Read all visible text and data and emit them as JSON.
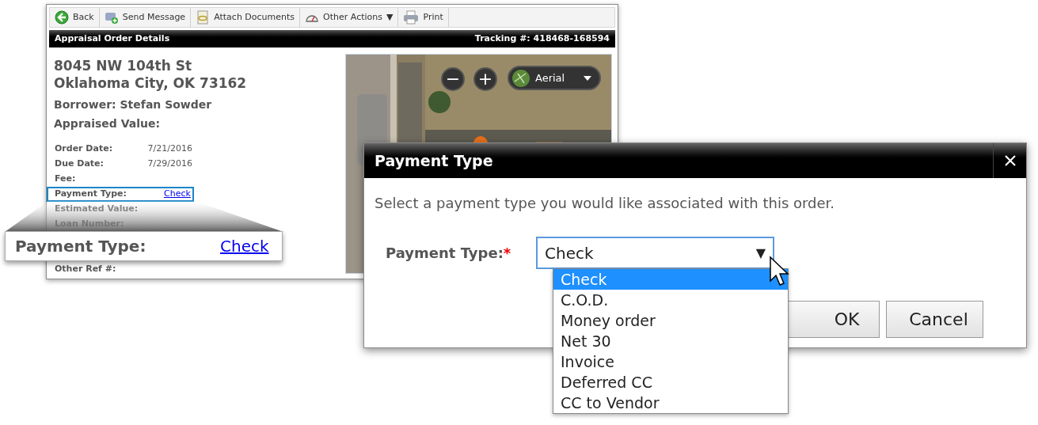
{
  "toolbar": [
    {
      "kind": "back",
      "label": "Back"
    },
    {
      "kind": "message",
      "label": "Send Message"
    },
    {
      "kind": "attach",
      "label": "Attach Documents"
    },
    {
      "kind": "actions",
      "label": "Other Actions",
      "caret": "▼"
    },
    {
      "kind": "print",
      "label": "Print"
    }
  ],
  "header": {
    "title": "Appraisal Order Details",
    "tracking": "Tracking #: 418468-168594"
  },
  "order": {
    "address_line_1": "8045 NW 104th St",
    "address_line_2": "Oklahoma City, OK 73162",
    "borrower": "Borrower: Stefan Sowder",
    "appraised_value": "Appraised Value:",
    "details": [
      {
        "label": "Order Date:",
        "value": "7/21/2016",
        "link": false,
        "highlighted": false
      },
      {
        "label": "Due Date:",
        "value": "7/29/2016",
        "link": false,
        "highlighted": false
      },
      {
        "label": "Fee:",
        "highlighted": false
      },
      {
        "label": "Payment Type:",
        "value": "Check",
        "link": true,
        "highlighted": true
      },
      {
        "label": "Estimated Value:",
        "highlighted": false
      },
      {
        "label": "Loan Number:",
        "highlighted": false
      }
    ],
    "details_lower": [
      {
        "label": "Other Ref #:",
        "highlighted": false
      }
    ]
  },
  "map": {
    "zoom_out": "−",
    "zoom_in": "+",
    "view": "Aerial"
  },
  "callout": {
    "label": "Payment Type:",
    "value": "Check"
  },
  "dialog": {
    "title": "Payment Type",
    "message": "Select a payment type you would like associated with this order.",
    "field_label": "Payment Type:",
    "required": "*",
    "value": "Check",
    "select_caret": "▼",
    "options": [
      {
        "label": "Check",
        "selected": true
      },
      {
        "label": "C.O.D.",
        "selected": false
      },
      {
        "label": "Money order",
        "selected": false
      },
      {
        "label": "Net 30",
        "selected": false
      },
      {
        "label": "Invoice",
        "selected": false
      },
      {
        "label": "Deferred CC",
        "selected": false
      },
      {
        "label": "CC to Vendor",
        "selected": false
      }
    ],
    "buttons": [
      "OK",
      "Cancel"
    ]
  }
}
